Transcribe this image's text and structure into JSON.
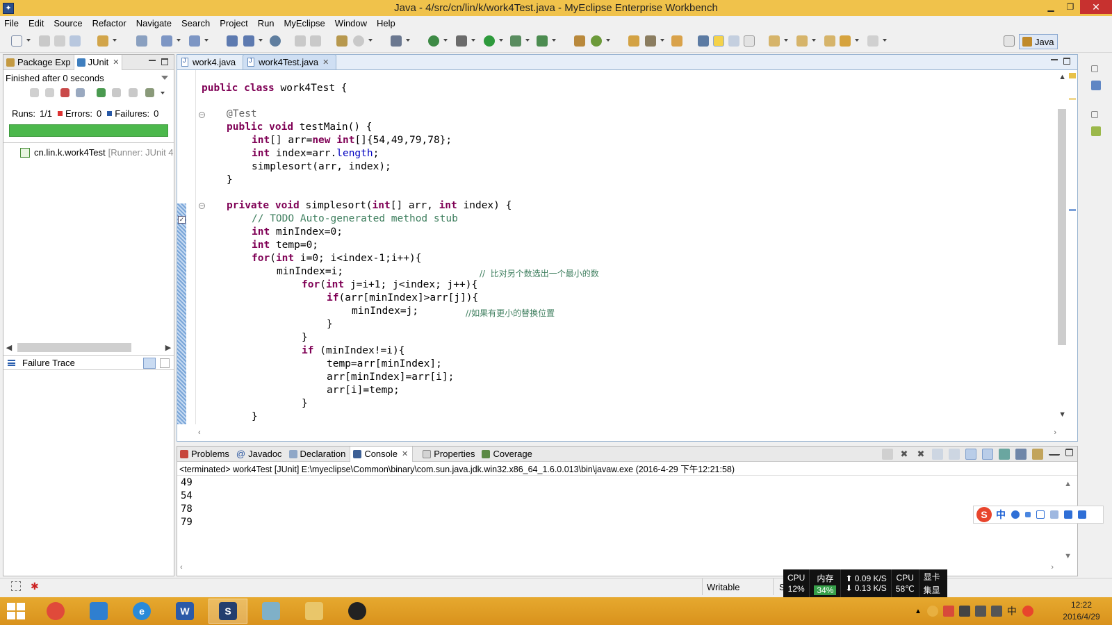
{
  "window": {
    "title": "Java - 4/src/cn/lin/k/work4Test.java - MyEclipse Enterprise Workbench"
  },
  "menu": [
    "File",
    "Edit",
    "Source",
    "Refactor",
    "Navigate",
    "Search",
    "Project",
    "Run",
    "MyEclipse",
    "Window",
    "Help"
  ],
  "perspective": {
    "label": "Java"
  },
  "left_panel": {
    "tabs": [
      {
        "label": "Package Exp",
        "icon": "package-explorer-icon"
      },
      {
        "label": "JUnit",
        "icon": "junit-icon"
      }
    ],
    "status": "Finished after 0 seconds",
    "runs_label": "Runs:",
    "runs_value": "1/1",
    "errors_label": "Errors:",
    "errors_value": "0",
    "failures_label": "Failures:",
    "failures_value": "0",
    "progress_fraction": 1.0,
    "progress_color": "#4cb84c",
    "test_item": {
      "name": "cn.lin.k.work4Test",
      "runner": "[Runner: JUnit 4"
    },
    "failure_trace_label": "Failure Trace"
  },
  "editor": {
    "tabs": [
      {
        "label": "work4.java",
        "active": false
      },
      {
        "label": "work4Test.java",
        "active": true
      }
    ],
    "code": {
      "l1_kw1": "public",
      "l1_kw2": "class",
      "l1_rest": " work4Test {",
      "l2_ann": "@Test",
      "l3_kw1": "public",
      "l3_kw2": "void",
      "l3_rest": " testMain() {",
      "l4_kw1": "int",
      "l4_mid": "[] arr=",
      "l4_kw2": "new",
      "l4_kw3": "int",
      "l4_rest": "[]{54,49,79,78};",
      "l5_kw": "int",
      "l5_mid": " index=arr.",
      "l5_field": "length",
      "l5_rest": ";",
      "l6": "simplesort(arr, index);",
      "l7": "}",
      "l8_kw1": "private",
      "l8_kw2": "void",
      "l8_mid": " simplesort(",
      "l8_kw3": "int",
      "l8_mid2": "[] arr, ",
      "l8_kw4": "int",
      "l8_rest": " index) {",
      "l9": "// TODO Auto-generated method stub",
      "l10_kw": "int",
      "l10_rest": " minIndex=0;",
      "l11_kw": "int",
      "l11_rest": " temp=0;",
      "l12_kw1": "for",
      "l12_mid": "(",
      "l12_kw2": "int",
      "l12_rest": " i=0; i<index-1;i++){",
      "l13_code": "minIndex=i;",
      "l13_comment": "//  比对另个数选出一个最小的数",
      "l14_kw1": "for",
      "l14_mid": "(",
      "l14_kw2": "int",
      "l14_rest": " j=i+1; j<index; j++){",
      "l15_kw": "if",
      "l15_rest": "(arr[minIndex]>arr[j]){",
      "l16_code": "minIndex=j;",
      "l16_comment": "//如果有更小的替换位置",
      "l17": "}",
      "l18": "}",
      "l19_kw": "if",
      "l19_rest": " (minIndex!=i){",
      "l20": "temp=arr[minIndex];",
      "l21": "arr[minIndex]=arr[i];",
      "l22": "arr[i]=temp;",
      "l23": "}",
      "l24": "}"
    }
  },
  "bottom_panel": {
    "tabs": [
      {
        "label": "Problems",
        "icon": "problems-icon",
        "active": false
      },
      {
        "label": "Javadoc",
        "icon": "javadoc-icon",
        "active": false
      },
      {
        "label": "Declaration",
        "icon": "declaration-icon",
        "active": false
      },
      {
        "label": "Console",
        "icon": "console-icon",
        "active": true
      },
      {
        "label": "Properties",
        "icon": "properties-icon",
        "active": false
      },
      {
        "label": "Coverage",
        "icon": "coverage-icon",
        "active": false
      }
    ],
    "console_header": "<terminated> work4Test [JUnit] E:\\myeclipse\\Common\\binary\\com.sun.java.jdk.win32.x86_64_1.6.0.013\\bin\\javaw.exe (2016-4-29 下午12:21:58)",
    "output": [
      "49",
      "54",
      "78",
      "79"
    ]
  },
  "ime": {
    "logo": "S",
    "mode": "中"
  },
  "status_bar": {
    "writable": "Writable",
    "insert_mode": "S"
  },
  "monitor": {
    "cpu_label": "CPU",
    "cpu_value": "12%",
    "mem_label": "内存",
    "mem_value": "34%",
    "up_speed": "0.09 K/S",
    "down_speed": "0.13 K/S",
    "cpu2_label": "CPU",
    "cpu2_value": "58℃",
    "gpu_label": "显卡",
    "gpu_value": "集显"
  },
  "taskbar": {
    "apps": [
      "chrome-icon",
      "bird-icon",
      "internet-explorer-icon",
      "word-icon",
      "myeclipse-icon",
      "notepad-icon",
      "file-explorer-icon",
      "qq-icon"
    ],
    "tray_ime": "中",
    "time": "12:22",
    "date": "2016/4/29"
  },
  "colors": {
    "title_bar": "#f0c24b",
    "taskbar": "#d9921c",
    "keyword": "#7f0055",
    "comment": "#3f7f5f",
    "field": "#0000c0"
  }
}
